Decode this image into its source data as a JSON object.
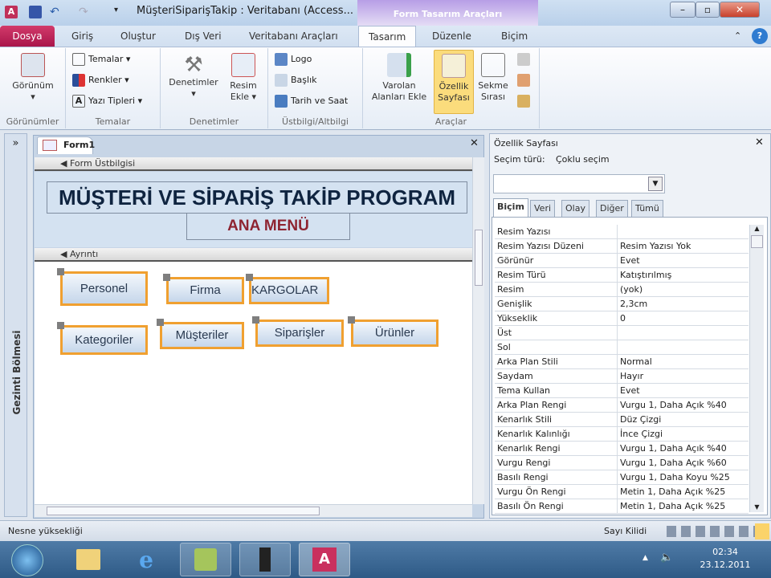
{
  "window": {
    "title": "MüşteriSiparişTakip : Veritabanı (Access...",
    "context_tab": "Form Tasarım Araçları",
    "minimize": "–",
    "restore": "▫",
    "close": "✕"
  },
  "tabs": {
    "file": "Dosya",
    "items": [
      "Giriş",
      "Oluştur",
      "Dış Veri",
      "Veritabanı Araçları",
      "Tasarım",
      "Düzenle",
      "Biçim"
    ]
  },
  "ribbon": {
    "gorunumler": {
      "label": "Görünümler",
      "view": "Görünüm"
    },
    "temalar": {
      "label": "Temalar",
      "themes": "Temalar ▾",
      "colors": "Renkler ▾",
      "fonts": "Yazı Tipleri ▾"
    },
    "denetimler": {
      "label": "Denetimler",
      "controls": "Denetimler",
      "image": "Resim Ekle ▾"
    },
    "ustbilgi": {
      "label": "Üstbilgi/Altbilgi",
      "logo": "Logo",
      "title": "Başlık",
      "datetime": "Tarih ve Saat"
    },
    "araclar": {
      "label": "Araçlar",
      "existing": "Varolan Alanları Ekle",
      "props": "Özellik Sayfası",
      "taborder": "Sekme Sırası"
    }
  },
  "nav": {
    "expand": "»",
    "label": "Gezinti Bölmesi"
  },
  "form": {
    "tab": "Form1",
    "close": "✕",
    "header_section": "Form Üstbilgisi",
    "detail_section": "Ayrıntı",
    "title": "MÜŞTERİ VE SİPARİŞ TAKİP PROGRAM",
    "subtitle": "ANA MENÜ",
    "buttons": [
      "Personel",
      "Firma",
      "KARGOLAR",
      "Kategoriler",
      "Müşteriler",
      "Siparişler",
      "Ürünler"
    ]
  },
  "property_sheet": {
    "title": "Özellik Sayfası",
    "close": "✕",
    "selection_label": "Seçim türü:",
    "selection_value": "Çoklu seçim",
    "combo_value": "",
    "tabs": [
      "Biçim",
      "Veri",
      "Olay",
      "Diğer",
      "Tümü"
    ],
    "rows": [
      [
        "Resim Yazısı",
        ""
      ],
      [
        "Resim Yazısı Düzeni",
        "Resim Yazısı Yok"
      ],
      [
        "Görünür",
        "Evet"
      ],
      [
        "Resim Türü",
        "Katıştırılmış"
      ],
      [
        "Resim",
        "(yok)"
      ],
      [
        "Genişlik",
        "2,3cm"
      ],
      [
        "Yükseklik",
        "0"
      ],
      [
        "Üst",
        ""
      ],
      [
        "Sol",
        ""
      ],
      [
        "Arka Plan Stili",
        "Normal"
      ],
      [
        "Saydam",
        "Hayır"
      ],
      [
        "Tema Kullan",
        "Evet"
      ],
      [
        "Arka Plan Rengi",
        "Vurgu 1, Daha Açık %40"
      ],
      [
        "Kenarlık Stili",
        "Düz Çizgi"
      ],
      [
        "Kenarlık Kalınlığı",
        "İnce Çizgi"
      ],
      [
        "Kenarlık Rengi",
        "Vurgu 1, Daha Açık %40"
      ],
      [
        "Vurgu Rengi",
        "Vurgu 1, Daha Açık %60"
      ],
      [
        "Basılı Rengi",
        "Vurgu 1, Daha Koyu %25"
      ],
      [
        "Vurgu Ön Rengi",
        "Metin 1, Daha Açık %25"
      ],
      [
        "Basılı Ön Rengi",
        "Metin 1, Daha Açık %25"
      ]
    ]
  },
  "status": {
    "text": "Nesne yüksekliği",
    "numlock": "Sayı Kilidi"
  },
  "taskbar": {
    "time": "02:34",
    "date": "23.12.2011"
  }
}
